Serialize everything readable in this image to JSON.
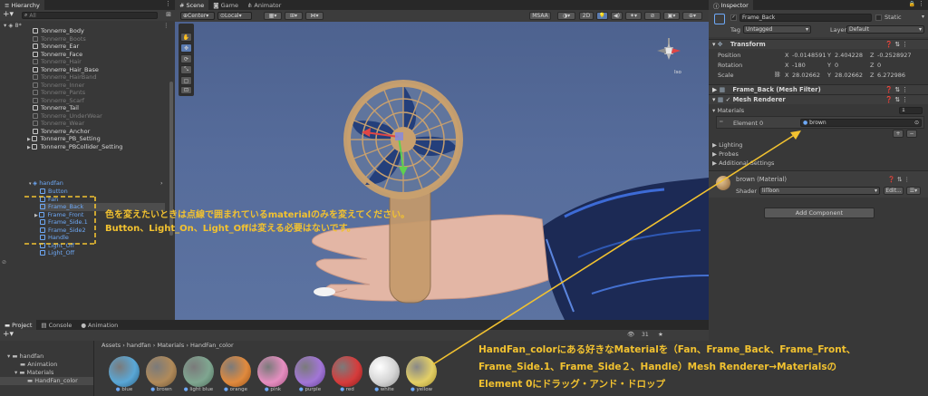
{
  "hierarchy": {
    "tab": "Hierarchy",
    "search_placeholder": "All",
    "scene": "8*",
    "items": [
      {
        "label": "Tonnerre_Body",
        "style": "white"
      },
      {
        "label": "Tonnerre_Boots",
        "style": "gray"
      },
      {
        "label": "Tonnerre_Ear",
        "style": "white"
      },
      {
        "label": "Tonnerre_Face",
        "style": "white"
      },
      {
        "label": "Tonnerre_Hair",
        "style": "gray"
      },
      {
        "label": "Tonnerre_Hair_Base",
        "style": "white"
      },
      {
        "label": "Tonnerre_HairBand",
        "style": "gray"
      },
      {
        "label": "Tonnerre_Inner",
        "style": "gray"
      },
      {
        "label": "Tonnerre_Pants",
        "style": "gray"
      },
      {
        "label": "Tonnerre_Scarf",
        "style": "gray"
      },
      {
        "label": "Tonnerre_Tail",
        "style": "white"
      },
      {
        "label": "Tonnerre_UnderWear",
        "style": "gray"
      },
      {
        "label": "Tonnerre_Wear",
        "style": "gray"
      },
      {
        "label": "Tonnerre_Anchor",
        "style": "white"
      },
      {
        "label": "Tonnerre_PB_Setting",
        "style": "white"
      },
      {
        "label": "Tonnerre_PBCollider_Setting",
        "style": "white"
      }
    ],
    "handfan": {
      "label": "handfan",
      "children": [
        "Button",
        "Fan",
        "Frame_Back",
        "Frame_Front",
        "Frame_Side.1",
        "Frame_Side2",
        "Handle",
        "Light_Off",
        "Light_Off"
      ]
    }
  },
  "scene": {
    "tabs": [
      "Scene",
      "Game",
      "Animator"
    ],
    "pivot": "Center",
    "space": "Local",
    "msaa": "MSAA",
    "mode_2d": "2D",
    "iso_label": "Iso"
  },
  "inspector": {
    "tab": "Inspector",
    "object_name": "Frame_Back",
    "static_label": "Static",
    "tag_label": "Tag",
    "tag_value": "Untagged",
    "layer_label": "Layer",
    "layer_value": "Default",
    "transform": {
      "title": "Transform",
      "position": {
        "label": "Position",
        "x": "-0.0148591",
        "y": "2.404228",
        "z": "-0.2528927"
      },
      "rotation": {
        "label": "Rotation",
        "x": "-180",
        "y": "0",
        "z": "0"
      },
      "scale": {
        "label": "Scale",
        "x": "28.02662",
        "y": "28.02662",
        "z": "6.272986"
      }
    },
    "mesh_filter": "Frame_Back (Mesh Filter)",
    "mesh_renderer": "Mesh Renderer",
    "materials_label": "Materials",
    "materials_count": "1",
    "element_label": "Element 0",
    "element_value": "brown",
    "lighting": "Lighting",
    "probes": "Probes",
    "additional": "Additional Settings",
    "material_name": "brown (Material)",
    "shader_label": "Shader",
    "shader_value": "lilToon",
    "edit_label": "Edit...",
    "add_component": "Add Component"
  },
  "project": {
    "tabs": [
      "Project",
      "Console",
      "Animation"
    ],
    "count": "31",
    "tree": [
      "handfan",
      "Animation",
      "Materials",
      "HandFan_color"
    ],
    "breadcrumb": [
      "Assets",
      "handfan",
      "Materials",
      "HandFan_color"
    ],
    "assets": [
      {
        "name": "blue",
        "color": "#5aa7d6"
      },
      {
        "name": "brown",
        "color": "#b08a5a"
      },
      {
        "name": "light blue",
        "color": "#7fa690"
      },
      {
        "name": "orange",
        "color": "#e08a3e"
      },
      {
        "name": "pink",
        "color": "#e58ec0"
      },
      {
        "name": "purple",
        "color": "#a276d6"
      },
      {
        "name": "red",
        "color": "#d63c3c"
      },
      {
        "name": "white",
        "color": "#d4d4d4"
      },
      {
        "name": "yellow",
        "color": "#e3cf66"
      }
    ]
  },
  "annotations": {
    "note1_line1": "色を変えたいときは点線で囲まれているmaterialのみを変えてください。",
    "note1_line2": "Button、Light_On、Light_Offは変える必要はないです。",
    "note2_line1": "HandFan_colorにある好きなMaterialを（Fan、Frame_Back、Frame_Front、",
    "note2_line2": "Frame_Side.1、Frame_Side２、Handle）Mesh Renderer→Materialsの",
    "note2_line3": "Element 0にドラッグ・アンド・ドロップ"
  },
  "colors": {
    "accent_yellow": "#f2c230",
    "panel": "#383838",
    "scene_sky": "#4a5f8e",
    "selection_blue": "#6ea9f7"
  }
}
